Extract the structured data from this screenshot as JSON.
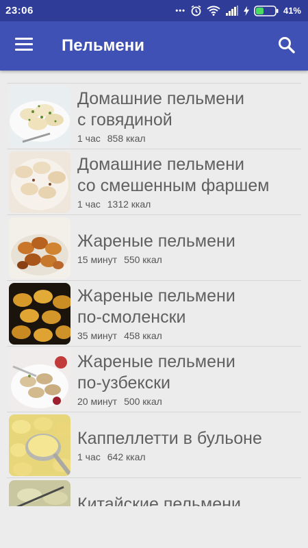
{
  "status_bar": {
    "time": "23:06",
    "dots": "•••",
    "battery_percent": "41%",
    "battery_level": 0.41
  },
  "app_bar": {
    "title": "Пельмени"
  },
  "recipes": [
    {
      "title": "Домашние пельмени\nс говядиной",
      "time": "1 час",
      "kcal": "858 ккал",
      "image": "boiled-dumplings-with-dill"
    },
    {
      "title": "Домашние пельмени\nсо смешенным фаршем",
      "time": "1 час",
      "kcal": "1312 ккал",
      "image": "boiled-dumplings-plate"
    },
    {
      "title": "Жареные пельмени",
      "time": "15 минут",
      "kcal": "550 ккал",
      "image": "fried-dumplings-bowl"
    },
    {
      "title": "Жареные пельмени\nпо-смоленски",
      "time": "35 минут",
      "kcal": "458 ккал",
      "image": "fried-dumplings-pan"
    },
    {
      "title": "Жареные пельмени\nпо-узбекски",
      "time": "20 минут",
      "kcal": "500 ккал",
      "image": "dumplings-with-fork"
    },
    {
      "title": "Каппеллетти в бульоне",
      "time": "1 час",
      "kcal": "642 ккал",
      "image": "cappelletti-spoon"
    },
    {
      "title": "Китайские пельмени",
      "time": "",
      "kcal": "",
      "image": "chinese-dumplings"
    }
  ]
}
